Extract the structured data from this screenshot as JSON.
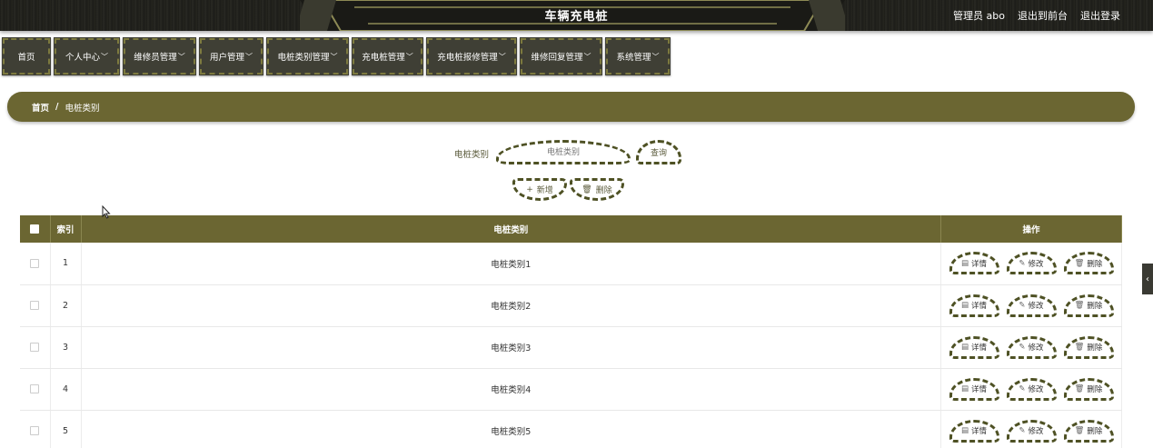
{
  "header": {
    "title": "车辆充电桩",
    "links": [
      "管理员 abo",
      "退出到前台",
      "退出登录"
    ]
  },
  "nav": {
    "items": [
      {
        "label": "首页",
        "dropdown": false
      },
      {
        "label": "个人中心",
        "dropdown": true
      },
      {
        "label": "维修员管理",
        "dropdown": true
      },
      {
        "label": "用户管理",
        "dropdown": true
      },
      {
        "label": "电桩类别管理",
        "dropdown": true
      },
      {
        "label": "充电桩管理",
        "dropdown": true
      },
      {
        "label": "充电桩报修管理",
        "dropdown": true
      },
      {
        "label": "维修回复管理",
        "dropdown": true
      },
      {
        "label": "系统管理",
        "dropdown": true
      }
    ]
  },
  "breadcrumb": {
    "home": "首页",
    "separator": "/",
    "current": "电桩类别"
  },
  "search": {
    "label": "电桩类别",
    "placeholder": "电桩类别",
    "query_label": "查询"
  },
  "actions": {
    "add_label": "新增",
    "delete_label": "删除"
  },
  "table": {
    "headers": {
      "index": "索引",
      "category": "电桩类别",
      "ops": "操作"
    },
    "rows": [
      {
        "index": "1",
        "category": "电桩类别1"
      },
      {
        "index": "2",
        "category": "电桩类别2"
      },
      {
        "index": "3",
        "category": "电桩类别3"
      },
      {
        "index": "4",
        "category": "电桩类别4"
      },
      {
        "index": "5",
        "category": "电桩类别5"
      }
    ],
    "row_actions": {
      "detail": "详情",
      "edit": "修改",
      "delete": "删除"
    }
  },
  "colors": {
    "accent": "#6b6632",
    "nav_bg": "#3f3f35",
    "dashed_border": "#4e5124"
  }
}
